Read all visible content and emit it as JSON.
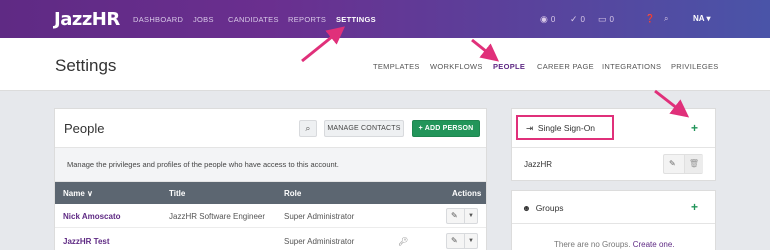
{
  "app": {
    "logo": "JazzHR"
  },
  "topnav": {
    "items": [
      "DASHBOARD",
      "JOBS",
      "CANDIDATES",
      "REPORTS",
      "SETTINGS"
    ],
    "active": "SETTINGS",
    "views_count": "0",
    "checks_count": "0",
    "inbox_count": "0",
    "user_initials": "NA"
  },
  "settings": {
    "title": "Settings",
    "tabs": [
      "TEMPLATES",
      "WORKFLOWS",
      "PEOPLE",
      "CAREER PAGE",
      "INTEGRATIONS",
      "PRIVILEGES"
    ],
    "active_tab": "PEOPLE"
  },
  "people": {
    "title": "People",
    "manage_label": "MANAGE CONTACTS",
    "add_label": "+ ADD PERSON",
    "description": "Manage the privileges and profiles of the people who have access to this account.",
    "columns": {
      "name": "Name ∨",
      "title": "Title",
      "role": "Role",
      "actions": "Actions"
    },
    "rows": [
      {
        "name": "Nick Amoscato",
        "title": "JazzHR Software Engineer",
        "role": "Super Administrator"
      },
      {
        "name": "JazzHR Test",
        "title": "",
        "role": "Super Administrator"
      }
    ]
  },
  "sso": {
    "title": "Single Sign-On",
    "plus": "+",
    "entries": [
      "JazzHR"
    ]
  },
  "groups": {
    "title": "Groups",
    "plus": "+",
    "empty_text": "There are no Groups.",
    "create_link": "Create one."
  },
  "colors": {
    "brand": "#5f2a84",
    "accent_green": "#22955a",
    "annotation": "#e0307a",
    "table_header": "#5c6671"
  }
}
